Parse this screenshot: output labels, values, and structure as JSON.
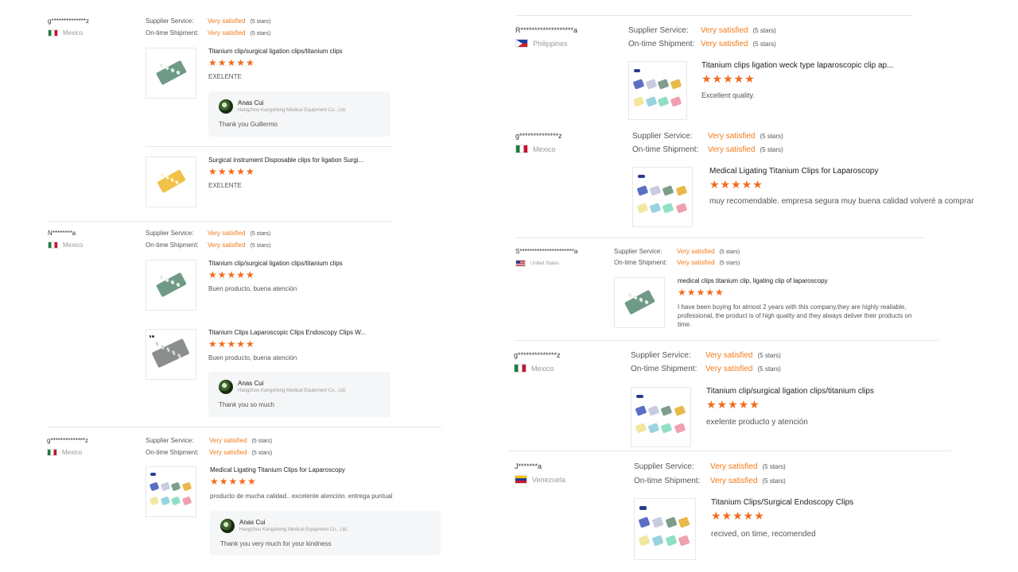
{
  "labels": {
    "supplier_service": "Supplier Service:",
    "ontime_shipment": "On-time Shipment:"
  },
  "colors": {
    "accent": "#f27a1a",
    "star": "#f26b1d"
  },
  "left": [
    {
      "buyer": "g**************z",
      "country": "Mexico",
      "flag": "mexico",
      "supplier_service": "Very satisfied",
      "supplier_stars": "(5 stars)",
      "ontime": "Very satisfied",
      "ontime_stars": "(5 stars)",
      "items": [
        {
          "title": "Titanium clip/surgical ligation clips/titanium clips",
          "stars": "★★★★★",
          "comment": "EXELENTE",
          "thumb": "green-clip",
          "reply": {
            "name": "Anas Cui",
            "company": "Hangzhou Kangsheng Medical Equipment Co., Ltd.",
            "text": "Thank you Guillermo"
          }
        },
        {
          "title": "Surgical instrument Disposable clips for ligation Surgi...",
          "stars": "★★★★★",
          "comment": "EXELENTE",
          "thumb": "yellow-clip"
        }
      ]
    },
    {
      "buyer": "N********a",
      "country": "Mexico",
      "flag": "mexico",
      "supplier_service": "Very satisfied",
      "supplier_stars": "(5 stars)",
      "ontime": "Very satisfied",
      "ontime_stars": "(5 stars)",
      "items": [
        {
          "title": "Titanium clip/surgical ligation clips/titanium clips",
          "stars": "★★★★★",
          "comment": "Buen producto, buena atención",
          "thumb": "green-clip"
        },
        {
          "title": "Titanium Clips Laparoscopic Clips Endoscopy Clips W...",
          "stars": "★★★★★",
          "comment": "Buen producto, buena atención",
          "thumb": "gray-clip",
          "reply": {
            "name": "Anas Cui",
            "company": "Hangzhou Kangsheng Medical Equipment Co., Ltd.",
            "text": "Thank you so much"
          }
        }
      ]
    },
    {
      "buyer": "g**************z",
      "country": "Mexico",
      "flag": "mexico",
      "supplier_service": "Very satisfied",
      "supplier_stars": "(5 stars)",
      "ontime": "Very satisfied",
      "ontime_stars": "(5 stars)",
      "items": [
        {
          "title": "Medical Ligating Titanium Clips for Laparoscopy",
          "stars": "★★★★★",
          "comment": "producto de mucha calidad.. excelente atención.  entrega puntual",
          "thumb": "multi-clip",
          "reply": {
            "name": "Anas Cui",
            "company": "Hangzhou Kangsheng Medical Equipment Co., Ltd.",
            "text": "Thank you very much for your kindness"
          }
        }
      ]
    }
  ],
  "right": [
    {
      "buyer": "R*******************a",
      "country": "Philippines",
      "flag": "philippines",
      "supplier_service": "Very satisfied",
      "supplier_stars": "(5 stars)",
      "ontime": "Very satisfied",
      "ontime_stars": "(5 stars)",
      "items": [
        {
          "title": "Titanium clips ligation weck type laparoscopic clip ap...",
          "stars": "★★★★★",
          "comment": "Excellent quality.",
          "thumb": "multi-clip"
        }
      ]
    },
    {
      "buyer": "g**************z",
      "country": "Mexico",
      "flag": "mexico",
      "supplier_service": "Very satisfied",
      "supplier_stars": "(5 stars)",
      "ontime": "Very satisfied",
      "ontime_stars": "(5 stars)",
      "items": [
        {
          "title": "Medical Ligating Titanium Clips for Laparoscopy",
          "stars": "★★★★★",
          "comment": "muy recomendable.  empresa segura muy buena calidad volveré a comprar",
          "thumb": "multi-clip"
        }
      ]
    },
    {
      "buyer": "S**********************a",
      "country": "United States",
      "flag": "usa",
      "supplier_service": "Very satisfied",
      "supplier_stars": "(5 stars)",
      "ontime": "Very satisfied",
      "ontime_stars": "(5 stars)",
      "items": [
        {
          "title": "medical clips titanium clip, ligating clip of laparoscopy",
          "stars": "★★★★★",
          "comment": "I have been buying for almost 2 years with this company,they are highly realiable, professional, the product is of high quality and they always deliver their products on time.",
          "thumb": "green-clip"
        }
      ]
    },
    {
      "buyer": "g**************z",
      "country": "Mexico",
      "flag": "mexico",
      "supplier_service": "Very satisfied",
      "supplier_stars": "(5 stars)",
      "ontime": "Very satisfied",
      "ontime_stars": "(5 stars)",
      "items": [
        {
          "title": "Titanium clip/surgical ligation clips/titanium clips",
          "stars": "★★★★★",
          "comment": "exelente producto y atención",
          "thumb": "multi-clip"
        }
      ]
    },
    {
      "buyer": "J*******a",
      "country": "Venezuela",
      "flag": "venezuela",
      "supplier_service": "Very satisfied",
      "supplier_stars": "(5 stars)",
      "ontime": "Very satisfied",
      "ontime_stars": "(5 stars)",
      "items": [
        {
          "title": "Titanium Clips/Surgical Endoscopy Clips",
          "stars": "★★★★★",
          "comment": "recived, on time, recomended",
          "thumb": "multi-clip"
        }
      ]
    }
  ]
}
